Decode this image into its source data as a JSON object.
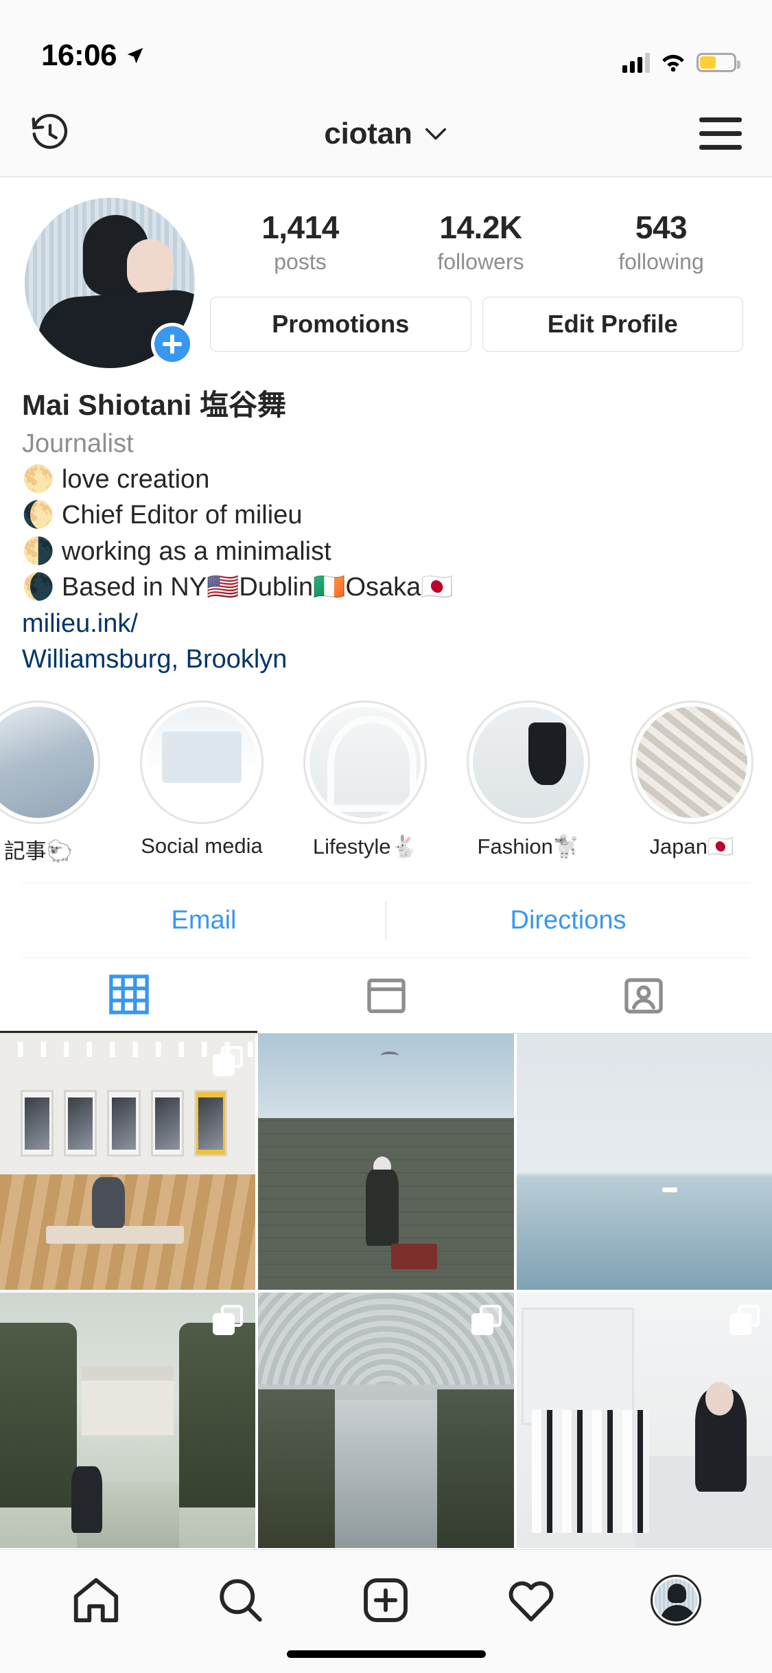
{
  "status_bar": {
    "time": "16:06",
    "location_icon": "location-arrow-icon",
    "signal_icon": "cellular-signal-icon",
    "wifi_icon": "wifi-icon",
    "battery_icon": "battery-low-power-icon",
    "battery_color": "#fdd037"
  },
  "navbar": {
    "archive_icon": "clock-history-icon",
    "username": "ciotan",
    "chevron_icon": "chevron-down-icon",
    "menu_icon": "hamburger-menu-icon"
  },
  "profile": {
    "avatar_name": "profile-avatar",
    "add_story_icon": "plus-icon",
    "stats": [
      {
        "num": "1,414",
        "label": "posts"
      },
      {
        "num": "14.2K",
        "label": "followers"
      },
      {
        "num": "543",
        "label": "following"
      }
    ],
    "buttons": [
      {
        "label": "Promotions",
        "name": "promotions-button"
      },
      {
        "label": "Edit Profile",
        "name": "edit-profile-button"
      }
    ],
    "bio": {
      "display_name": "Mai Shiotani 塩谷舞",
      "category": "Journalist",
      "lines": [
        "🌕 love creation",
        "🌔 Chief Editor of milieu",
        "🌗 working as a minimalist",
        "🌘 Based in NY🇺🇸Dublin🇮🇪Osaka🇯🇵"
      ],
      "website": "milieu.ink/",
      "address": "Williamsburg, Brooklyn"
    }
  },
  "highlights": [
    {
      "label": "記事🐑",
      "name": "highlight-kiji"
    },
    {
      "label": "Social media",
      "name": "highlight-social-media"
    },
    {
      "label": "Lifestyle🐇",
      "name": "highlight-lifestyle"
    },
    {
      "label": "Fashion🐩",
      "name": "highlight-fashion"
    },
    {
      "label": "Japan🇯🇵",
      "name": "highlight-japan"
    }
  ],
  "actions": {
    "email": "Email",
    "directions": "Directions",
    "link_color": "#3897f0"
  },
  "tabs": [
    {
      "name": "tab-grid",
      "icon": "grid-icon",
      "active": true
    },
    {
      "name": "tab-list",
      "icon": "list-view-icon",
      "active": false
    },
    {
      "name": "tab-tagged",
      "icon": "tagged-person-icon",
      "active": false
    }
  ],
  "grid_posts": [
    {
      "name": "post-gallery-exhibition",
      "multi": true
    },
    {
      "name": "post-man-on-wall",
      "multi": false
    },
    {
      "name": "post-sea-horizon",
      "multi": false
    },
    {
      "name": "post-garden-palace",
      "multi": true
    },
    {
      "name": "post-canal-path",
      "multi": true
    },
    {
      "name": "post-studio-interior",
      "multi": true
    }
  ],
  "bottom_nav": [
    {
      "name": "nav-home",
      "icon": "home-icon"
    },
    {
      "name": "nav-search",
      "icon": "search-icon"
    },
    {
      "name": "nav-new-post",
      "icon": "plus-square-icon"
    },
    {
      "name": "nav-activity",
      "icon": "heart-icon"
    },
    {
      "name": "nav-profile",
      "icon": "profile-avatar-icon"
    }
  ]
}
